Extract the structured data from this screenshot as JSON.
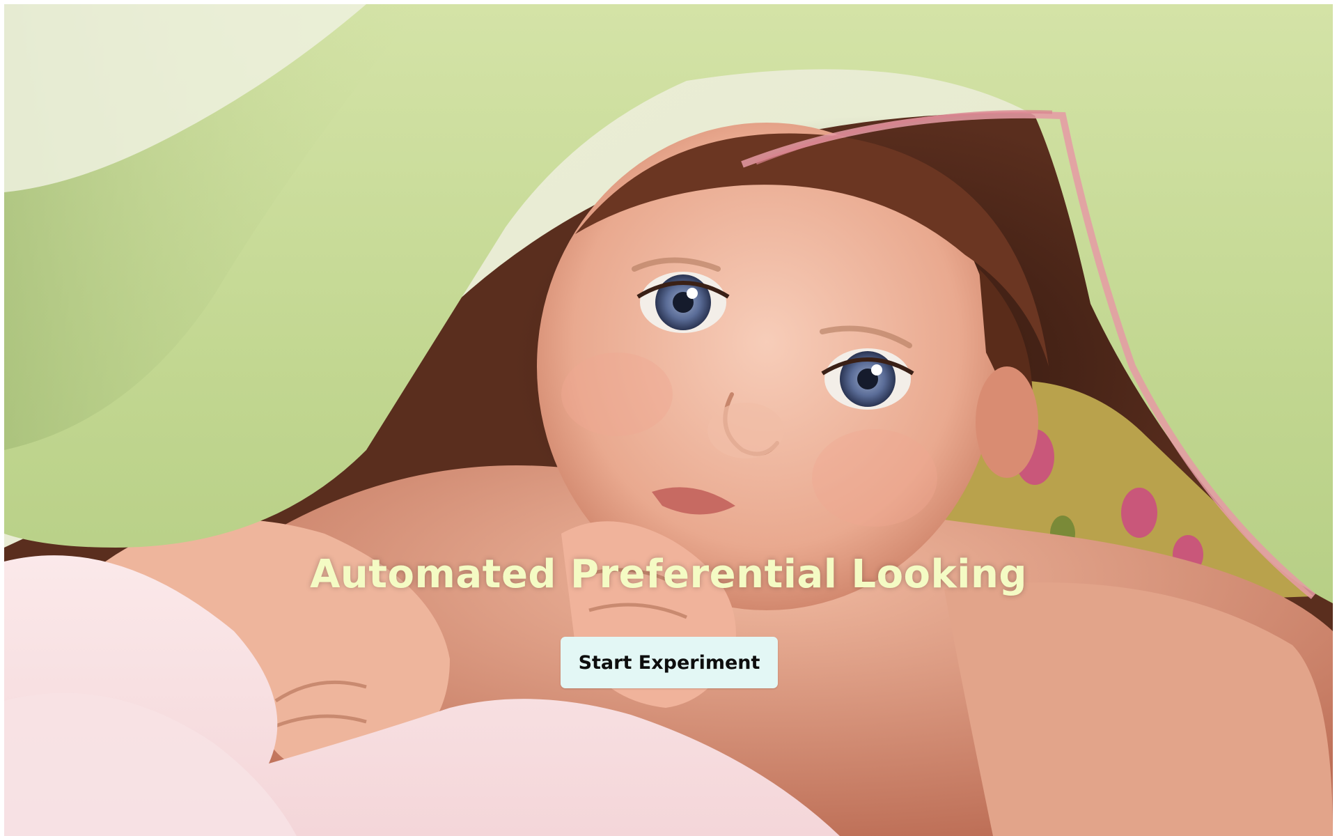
{
  "page": {
    "title": "Automated Preferential Looking",
    "start_button_label": "Start Experiment"
  },
  "hero_image": {
    "subject": "baby-under-blanket-photo"
  },
  "colors": {
    "title": "#f4fbc4",
    "button_bg": "#e3f7f5",
    "button_text": "#0e0e0e"
  }
}
